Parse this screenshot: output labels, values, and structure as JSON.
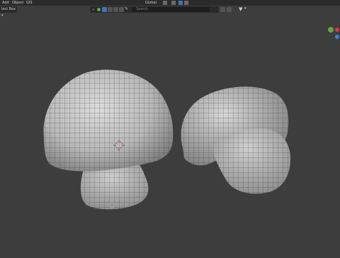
{
  "menu": {
    "add": "Add",
    "object": "Object",
    "gis": "GIS"
  },
  "toolbar": {
    "mode_label": "lect Box",
    "mode_caret": "▾",
    "orientation": "Global",
    "search_placeholder": "Search"
  },
  "gizmo": {
    "x_color": "#d9384a",
    "y_color": "#6ca23a",
    "z_color": "#3f7fd6"
  },
  "colors": {
    "background": "#3d3d3d",
    "menubar": "#2b2b2b",
    "accent": "#4772b3"
  }
}
